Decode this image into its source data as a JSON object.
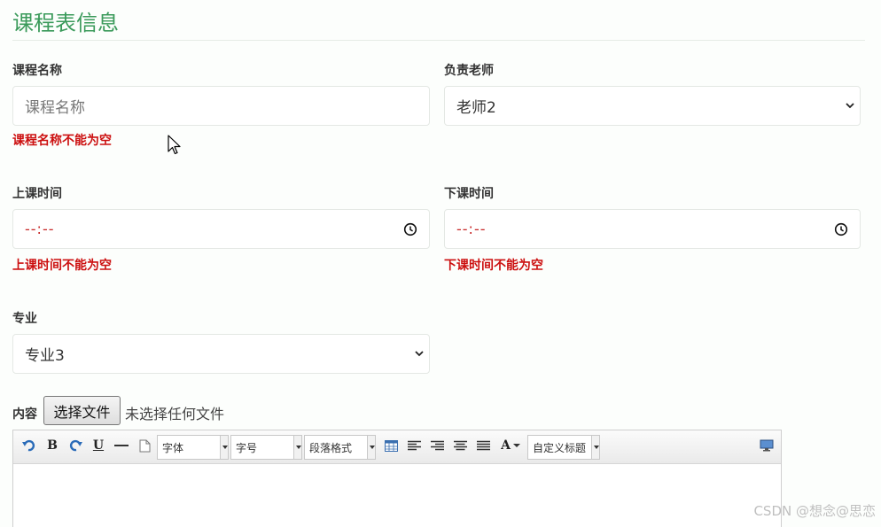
{
  "page": {
    "title": "课程表信息"
  },
  "form": {
    "course_name": {
      "label": "课程名称",
      "placeholder": "课程名称",
      "error": "课程名称不能为空"
    },
    "teacher": {
      "label": "负责老师",
      "selected": "老师2"
    },
    "start_time": {
      "label": "上课时间",
      "value": "--:--",
      "error": "上课时间不能为空"
    },
    "end_time": {
      "label": "下课时间",
      "value": "--:--",
      "error": "下课时间不能为空"
    },
    "major": {
      "label": "专业",
      "selected": "专业3"
    },
    "content": {
      "label": "内容",
      "file_button": "选择文件",
      "file_status": "未选择任何文件"
    }
  },
  "editor": {
    "toolbar": {
      "bold": "B",
      "underline": "U",
      "font_family": "字体",
      "font_size": "字号",
      "paragraph": "段落格式",
      "font_color": "A",
      "custom_title": "自定义标题"
    }
  },
  "watermark": "CSDN @想念@思恋",
  "colors": {
    "title": "#3a9a5a",
    "error": "#cc1010",
    "time_placeholder": "#c82828"
  }
}
